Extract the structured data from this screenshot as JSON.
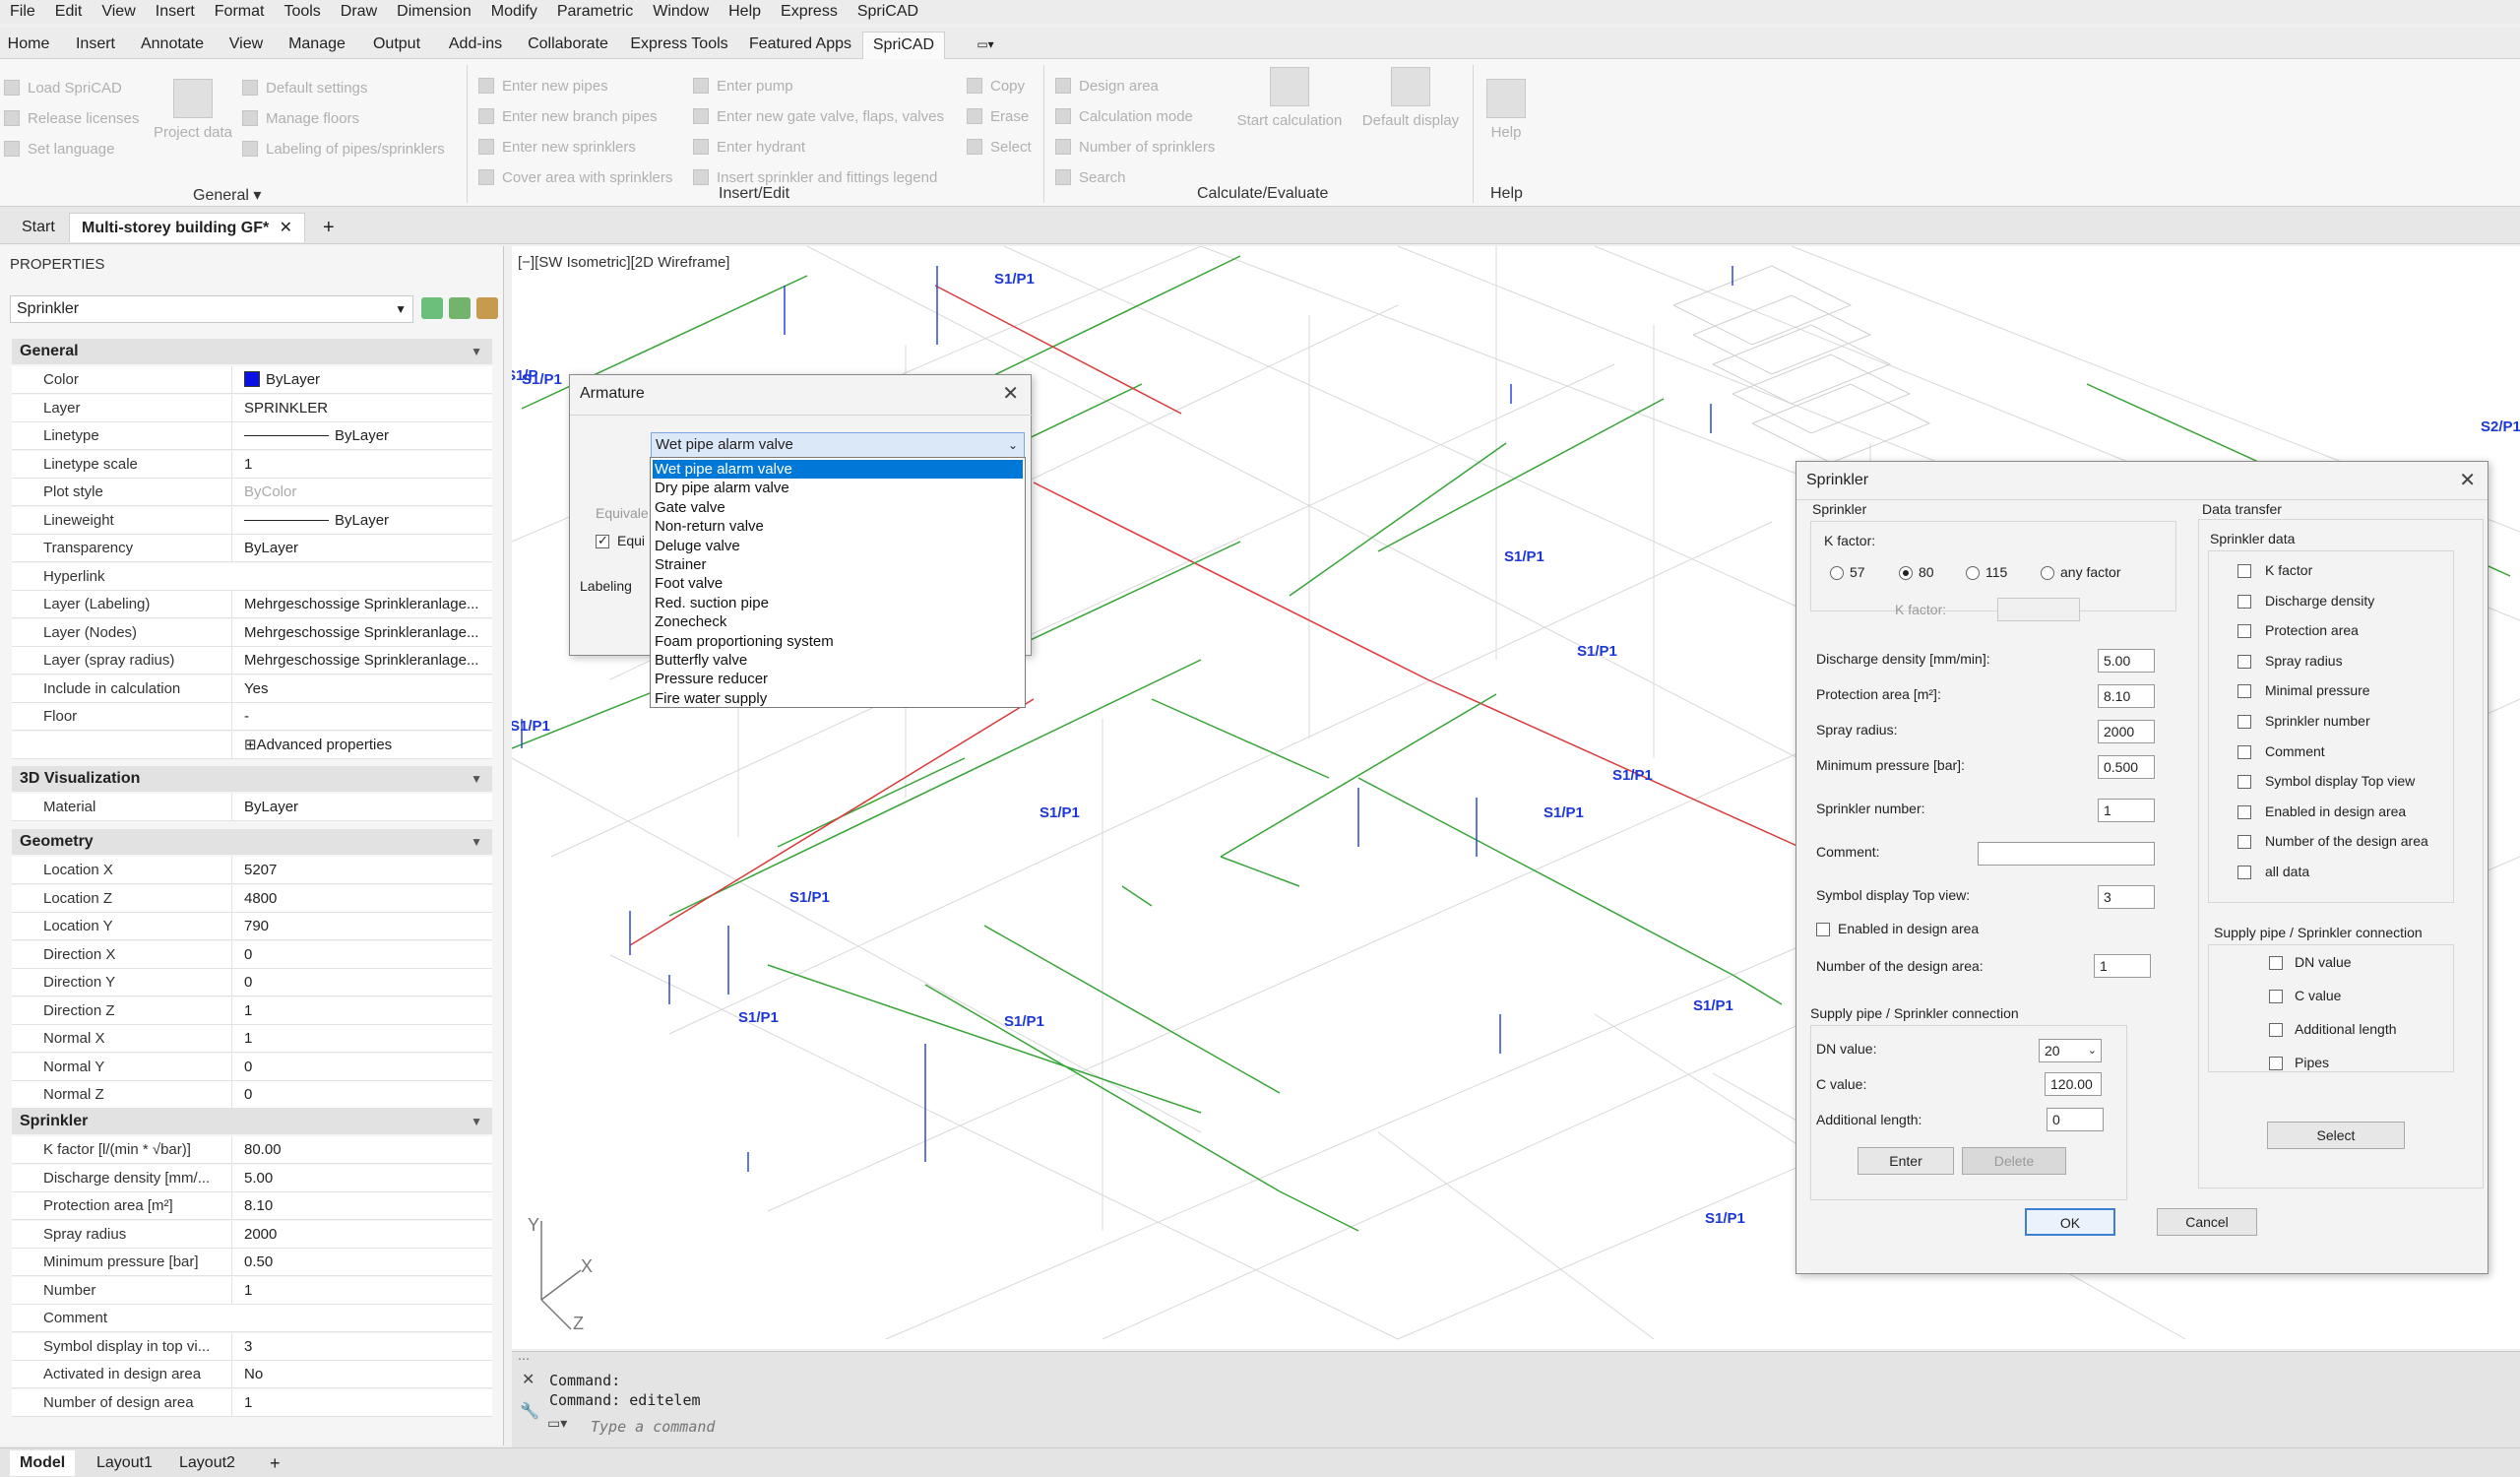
{
  "menu": [
    "File",
    "Edit",
    "View",
    "Insert",
    "Format",
    "Tools",
    "Draw",
    "Dimension",
    "Modify",
    "Parametric",
    "Window",
    "Help",
    "Express",
    "SpriCAD"
  ],
  "ribbon_tabs": [
    "Home",
    "Insert",
    "Annotate",
    "View",
    "Manage",
    "Output",
    "Add-ins",
    "Collaborate",
    "Express Tools",
    "Featured Apps",
    "SpriCAD"
  ],
  "ribbon": {
    "general": {
      "items": [
        "Load SpriCAD",
        "Release licenses",
        "Set language",
        "Project data",
        "Default settings",
        "Manage floors",
        "Labeling of pipes/sprinklers"
      ],
      "label": "General"
    },
    "insert_edit": {
      "items": [
        "Enter new pipes",
        "Enter new branch pipes",
        "Enter new sprinklers",
        "Cover area with sprinklers",
        "Enter pump",
        "Enter new gate valve, flaps, valves",
        "Enter hydrant",
        "Insert sprinkler and fittings legend",
        "Copy",
        "Erase",
        "Select"
      ],
      "label": "Insert/Edit"
    },
    "calc": {
      "items": [
        "Design area",
        "Calculation mode",
        "Number of sprinklers",
        "Search",
        "Start calculation",
        "Default display"
      ],
      "label": "Calculate/Evaluate"
    },
    "help": {
      "items": [
        "Help"
      ],
      "label": "Help"
    }
  },
  "doc_tabs": {
    "start": "Start",
    "active": "Multi-storey building GF*",
    "close": "✕",
    "add": "+"
  },
  "properties": {
    "title": "PROPERTIES",
    "selector": "Sprinkler",
    "sections": {
      "general": {
        "title": "General",
        "rows": [
          [
            "Color",
            "ByLayer"
          ],
          [
            "Layer",
            "SPRINKLER"
          ],
          [
            "Linetype",
            "ByLayer"
          ],
          [
            "Linetype scale",
            "1"
          ],
          [
            "Plot style",
            "ByColor"
          ],
          [
            "Lineweight",
            "ByLayer"
          ],
          [
            "Transparency",
            "ByLayer"
          ],
          [
            "Hyperlink",
            ""
          ],
          [
            "Layer (Labeling)",
            "Mehrgeschossige Sprinkleranlage..."
          ],
          [
            "Layer (Nodes)",
            "Mehrgeschossige Sprinkleranlage..."
          ],
          [
            "Layer (spray radius)",
            "Mehrgeschossige Sprinkleranlage..."
          ],
          [
            "Include in calculation",
            "Yes"
          ],
          [
            "Floor",
            "-"
          ],
          [
            "",
            "Advanced properties"
          ]
        ]
      },
      "viz": {
        "title": "3D Visualization",
        "rows": [
          [
            "Material",
            "ByLayer"
          ]
        ]
      },
      "geometry": {
        "title": "Geometry",
        "rows": [
          [
            "Location X",
            "5207"
          ],
          [
            "Location Z",
            "4800"
          ],
          [
            "Location Y",
            "790"
          ],
          [
            "Direction X",
            "0"
          ],
          [
            "Direction Y",
            "0"
          ],
          [
            "Direction Z",
            "1"
          ],
          [
            "Normal X",
            "1"
          ],
          [
            "Normal Y",
            "0"
          ],
          [
            "Normal Z",
            "0"
          ]
        ]
      },
      "sprinkler": {
        "title": "Sprinkler",
        "rows": [
          [
            "K factor [l/(min * √bar)]",
            "80.00"
          ],
          [
            "Discharge density [mm/...",
            "5.00"
          ],
          [
            "Protection area [m²]",
            "8.10"
          ],
          [
            "Spray radius",
            "2000"
          ],
          [
            "Minimum pressure [bar]",
            "0.50"
          ],
          [
            "Number",
            "1"
          ],
          [
            "Comment",
            ""
          ],
          [
            "Symbol display in top vi...",
            "3"
          ],
          [
            "Activated in design area",
            "No"
          ],
          [
            "Number of design area",
            "1"
          ]
        ]
      }
    }
  },
  "viewport": {
    "label": "[−][SW Isometric][2D Wireframe]",
    "tags": [
      "S1/P1",
      "S1/P1",
      "S1/P1",
      "S1/P1",
      "S1/P1",
      "S1/P1",
      "S1/P1",
      "S1/P1",
      "S1/P1",
      "S1/P1",
      "S1/P1",
      "S1/P1",
      "S1/P1",
      "S2/P1",
      "S1/P",
      "S1/P1"
    ],
    "axis": {
      "x": "X",
      "y": "Y",
      "z": "Z"
    }
  },
  "armature": {
    "title": "Armature",
    "selected": "Wet pipe alarm valve",
    "options": [
      "Wet pipe alarm valve",
      "Dry pipe alarm valve",
      "Gate valve",
      "Non-return valve",
      "Deluge valve",
      "Strainer",
      "Foot valve",
      "Red. suction pipe",
      "Zonecheck",
      "Foam proportioning system",
      "Butterfly valve",
      "Pressure reducer",
      "Fire water supply"
    ],
    "partial": [
      "Equivale",
      "Equi",
      "Labeling"
    ]
  },
  "sprinkler_dlg": {
    "title": "Sprinkler",
    "group": "Sprinkler",
    "kfactor_label": "K factor:",
    "k_opts": [
      "57",
      "80",
      "115",
      "any factor"
    ],
    "k_input_label": "K factor:",
    "fields": [
      [
        "Discharge density [mm/min]:",
        "5.00"
      ],
      [
        "Protection area [m²]:",
        "8.10"
      ],
      [
        "Spray radius:",
        "2000"
      ],
      [
        "Minimum pressure [bar]:",
        "0.500"
      ],
      [
        "Sprinkler number:",
        "1"
      ],
      [
        "Comment:",
        ""
      ],
      [
        "Symbol display Top view:",
        "3"
      ]
    ],
    "enabled_label": "Enabled in design area",
    "design_area": [
      "Number of the design area:",
      "1"
    ],
    "supply_title": "Supply pipe / Sprinkler connection",
    "dn": [
      "DN value:",
      "20"
    ],
    "c": [
      "C value:",
      "120.00"
    ],
    "al": [
      "Additional length:",
      "0"
    ],
    "enter": "Enter",
    "delete": "Delete",
    "dt_title": "Data transfer",
    "dt_group": "Sprinkler data",
    "dt_items": [
      "K factor",
      "Discharge density",
      "Protection area",
      "Spray radius",
      "Minimal pressure",
      "Sprinkler number",
      "Comment",
      "Symbol display Top view",
      "Enabled in design area",
      "Number of the design area",
      "all data"
    ],
    "dt_supply": "Supply pipe / Sprinkler connection",
    "dt_supply_items": [
      "DN value",
      "C value",
      "Additional length",
      "Pipes"
    ],
    "select": "Select",
    "ok": "OK",
    "cancel": "Cancel"
  },
  "command": {
    "line1": "Command:",
    "line2": "Command: editelem",
    "placeholder": "Type a command"
  },
  "layout_tabs": [
    "Model",
    "Layout1",
    "Layout2",
    "+"
  ]
}
